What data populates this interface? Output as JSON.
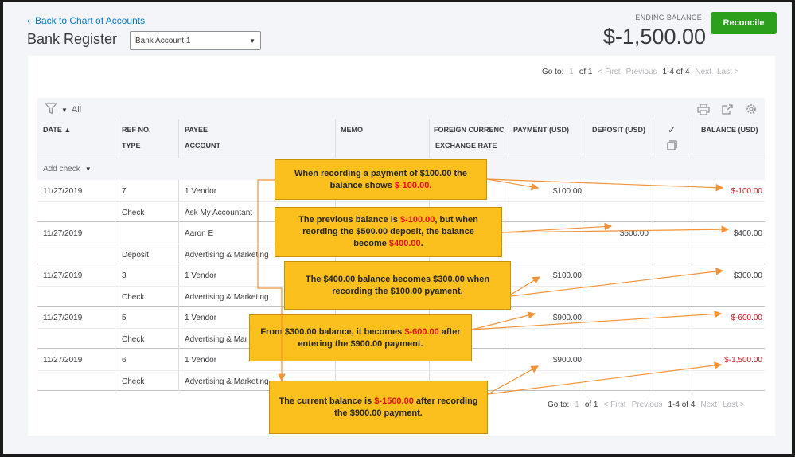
{
  "header": {
    "back_link": "Back to Chart of Accounts",
    "title": "Bank Register",
    "account_select": "Bank Account 1",
    "ending_balance_label": "ENDING BALANCE",
    "ending_balance": "$-1,500.00",
    "reconcile_label": "Reconcile"
  },
  "pager_top": {
    "goto_label": "Go to:",
    "page": "1",
    "of": "of 1",
    "first": "< First",
    "previous": "Previous",
    "range": "1-4 of 4",
    "next": "Next",
    "last": "Last >"
  },
  "pager_bottom": {
    "goto_label": "Go to:",
    "page": "1",
    "of": "of 1",
    "first": "< First",
    "previous": "Previous",
    "range": "1-4 of 4",
    "next": "Next",
    "last": "Last >"
  },
  "toolbar": {
    "filter_label": "All"
  },
  "columns": {
    "date": "DATE ▲",
    "ref": "REF NO.",
    "type": "TYPE",
    "payee": "PAYEE",
    "account": "ACCOUNT",
    "memo": "MEMO",
    "foreign": "FOREIGN CURRENC",
    "exchange": "EXCHANGE RATE",
    "payment": "PAYMENT (USD)",
    "deposit": "DEPOSIT (USD)",
    "check_mark": "✓",
    "balance": "BALANCE (USD)"
  },
  "add_check_label": "Add check",
  "transactions": [
    {
      "date": "11/27/2019",
      "ref": "7",
      "type": "Check",
      "payee": "1 Vendor",
      "account": "Ask My Accountant",
      "payment": "$100.00",
      "deposit": "",
      "balance": "$-100.00",
      "balance_negative": true
    },
    {
      "date": "11/27/2019",
      "ref": "",
      "type": "Deposit",
      "payee": "Aaron E",
      "account": "Advertising & Marketing",
      "payment": "",
      "deposit": "$500.00",
      "balance": "$400.00",
      "balance_negative": false
    },
    {
      "date": "11/27/2019",
      "ref": "3",
      "type": "Check",
      "payee": "1 Vendor",
      "account": "Advertising & Marketing",
      "payment": "$100.00",
      "deposit": "",
      "balance": "$300.00",
      "balance_negative": false
    },
    {
      "date": "11/27/2019",
      "ref": "5",
      "type": "Check",
      "payee": "1 Vendor",
      "account": "Advertising & Mar",
      "payment": "$900.00",
      "deposit": "",
      "balance": "$-600.00",
      "balance_negative": true
    },
    {
      "date": "11/27/2019",
      "ref": "6",
      "type": "Check",
      "payee": "1 Vendor",
      "account": "Advertising & Marketing",
      "payment": "$900.00",
      "deposit": "",
      "balance": "$-1,500.00",
      "balance_negative": true
    }
  ],
  "annotations": [
    {
      "line1_pre": "When recording a payment of $100.00  the",
      "line2_pre": "balance shows ",
      "highlight": "$-100.00.",
      "line2_post": ""
    },
    {
      "line1_pre": "The previous balance is ",
      "hl1": "$-100.00",
      "line1_post": ", but when",
      "line2": "reording the $500.00 deposit, the balance",
      "line3_pre": "become ",
      "hl3": "$400.00",
      "line3_post": "."
    },
    {
      "line1": "The $400.00 balance becomes $300.00 when",
      "line2": "recording the $100.00 pyament."
    },
    {
      "line1_pre": "From $300.00 balance, it becomes ",
      "hl1": "$-600.00",
      "line1_post": " after",
      "line2": "entering the $900.00 payment."
    },
    {
      "line1_pre": "The current balance is ",
      "hl1": "$-1500.00",
      "line1_post": " after recording",
      "line2": "the $900.00 payment."
    }
  ],
  "colors": {
    "accent_green": "#2ca01c",
    "link_blue": "#0077c5",
    "negative_red": "#e0131b",
    "annotation_yellow": "#fbc01e",
    "arrow_orange": "#f39237"
  },
  "icons": [
    "chevron-left-icon",
    "caret-down-icon",
    "filter-icon",
    "print-icon",
    "export-icon",
    "gear-icon",
    "checkmark-icon",
    "copy-icon"
  ]
}
